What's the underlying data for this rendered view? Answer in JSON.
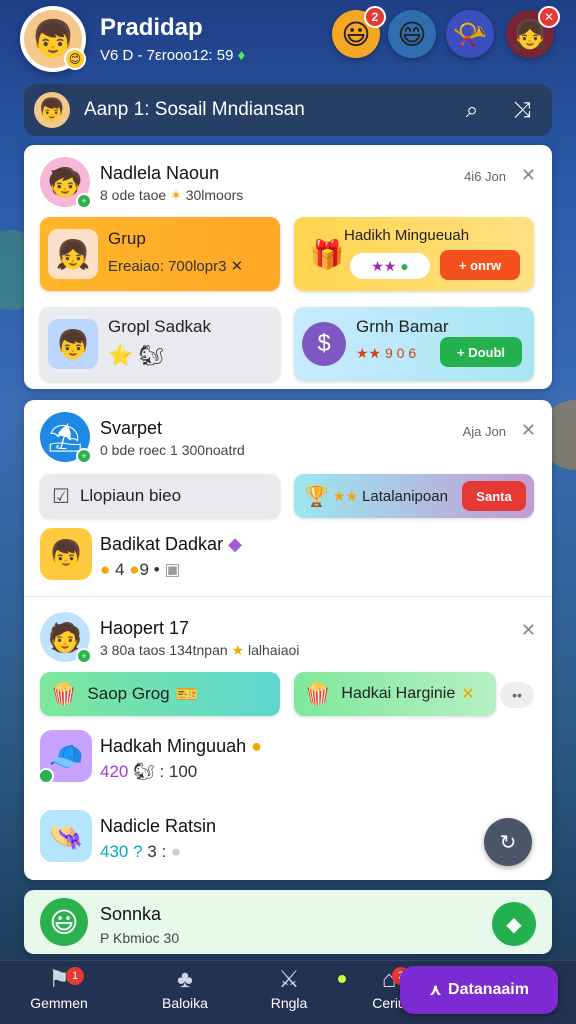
{
  "header": {
    "title": "Pradidap",
    "subtitle": "V6 D - 7εrooo12: 59",
    "subtitle_plus": "♦",
    "icons": [
      {
        "name": "emoji-icon",
        "glyph": "😃",
        "bg": "#f5a623",
        "badge": "2"
      },
      {
        "name": "face-icon",
        "glyph": "😄",
        "bg": "#2f6fb0",
        "badge": ""
      },
      {
        "name": "horn-icon",
        "glyph": "📯",
        "bg": "#3c4fbf",
        "badge": ""
      },
      {
        "name": "girl-avatar-icon",
        "glyph": "👧",
        "bg": "#7a2535",
        "badge": "✕"
      }
    ]
  },
  "search": {
    "text": "Aanp 1: Sosail Mndiansan",
    "search_glyph": "⌕",
    "shuffle_glyph": "⤨"
  },
  "card1": {
    "name": "Nadlela Naoun",
    "sub": "8 ode taoe",
    "sub_star": "✶",
    "sub_tail": "30lmoors",
    "time": "4i6 Jon",
    "close": "✕",
    "tiles": {
      "grup_title": "Grup",
      "grup_sub": "Ereaiao: 700lopr3",
      "grup_tag": "✕",
      "hadiah_title": "Hadikh Mingueuah",
      "hadiah_btn": "+ onrw",
      "gropl_title": "Gropl Sadkak",
      "grnh_title": "Grnh Bamar",
      "grnh_sub": "9 0 6",
      "grnh_btn": "+ Doubl"
    }
  },
  "card2": {
    "name": "Svarpet",
    "sub": "0 bde roec 1 300noatrd",
    "time": "Aja Jon",
    "close": "✕",
    "row_left": "Llopiaun bieo",
    "row_right": "Latalanipoan",
    "row_right_btn": "Santa",
    "list_name": "Badikat Dadkar",
    "list_sub_a": "4",
    "list_sub_b": "9"
  },
  "card3": {
    "name": "Haopert 17",
    "sub": "3 80a taos 134tnpan",
    "sub_star": "★",
    "sub_tail": "lalhaiaoi",
    "close": "✕",
    "tile_left": "Saop Grog",
    "tile_right": "Hadkai Harginie",
    "more": "••",
    "item1_name": "Hadkah Minguuah",
    "item1_sub": "420",
    "item1_tail": ": 100",
    "item2_name": "Nadicle Ratsin",
    "item2_sub": "430 ?",
    "item2_tail": "3 :",
    "fab": "↻"
  },
  "card4": {
    "name": "Sonnka",
    "sub": "P Kbmioc 30"
  },
  "nav": {
    "items": [
      {
        "label": "Gemmen",
        "glyph": "⚑",
        "badge": "1"
      },
      {
        "label": "Baloika",
        "glyph": "♣",
        "badge": ""
      },
      {
        "label": "Rngla",
        "glyph": "⚔",
        "badge": ""
      },
      {
        "label": "Ceriu",
        "glyph": "⌂",
        "badge": "3"
      }
    ],
    "cta": "Datanaaim",
    "cta_glyph": "⋏"
  }
}
